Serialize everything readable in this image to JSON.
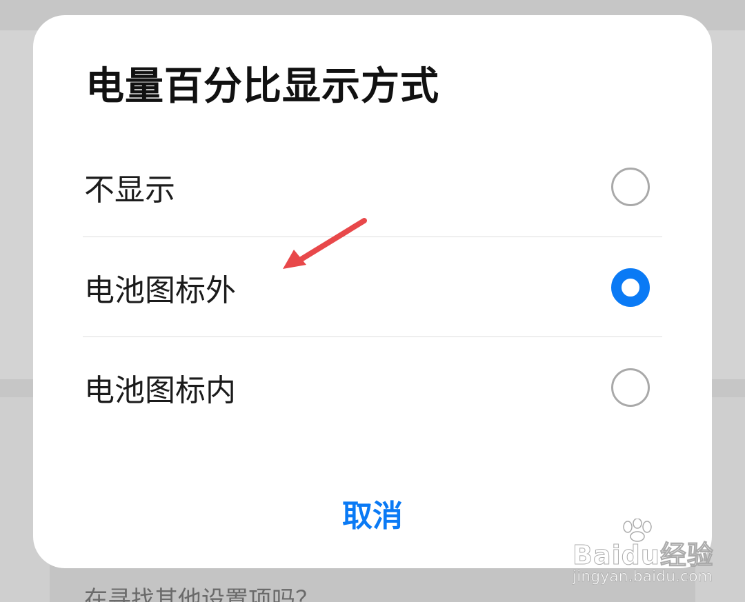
{
  "dialog": {
    "title": "电量百分比显示方式",
    "options": [
      {
        "label": "不显示",
        "selected": false
      },
      {
        "label": "电池图标外",
        "selected": true
      },
      {
        "label": "电池图标内",
        "selected": false
      }
    ],
    "cancel_label": "取消"
  },
  "background": {
    "footer_text": "在寻找其他设置项吗？"
  },
  "watermark": {
    "logo_text": "Baidu经验",
    "url": "jingyan.baidu.com"
  },
  "colors": {
    "accent": "#0a7af5",
    "annotation_arrow": "#e8484a",
    "dim_overlay": "#cfcfcf"
  }
}
